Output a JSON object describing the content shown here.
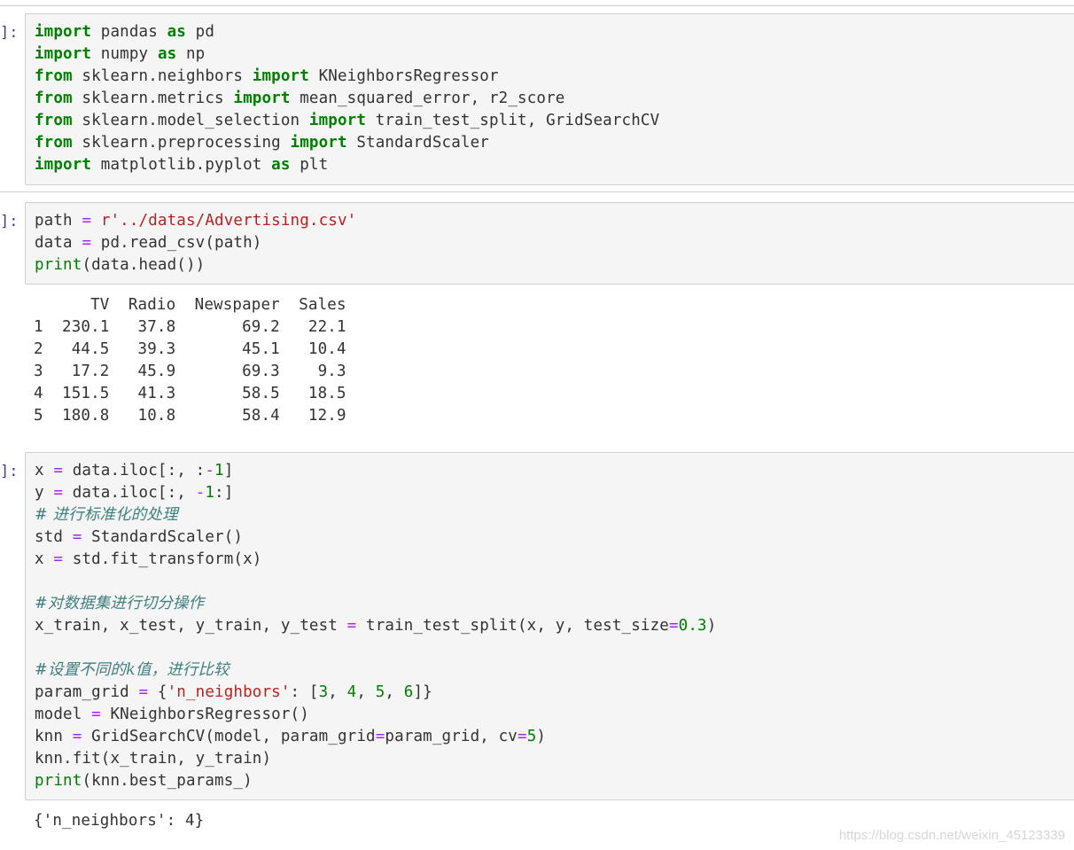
{
  "cells": [
    {
      "prompt": "]:",
      "lines": [
        [
          [
            "kw",
            "import"
          ],
          [
            "t",
            " pandas "
          ],
          [
            "kw",
            "as"
          ],
          [
            "t",
            " pd"
          ]
        ],
        [
          [
            "kw",
            "import"
          ],
          [
            "t",
            " numpy "
          ],
          [
            "kw",
            "as"
          ],
          [
            "t",
            " np"
          ]
        ],
        [
          [
            "kw",
            "from"
          ],
          [
            "t",
            " sklearn.neighbors "
          ],
          [
            "kw",
            "import"
          ],
          [
            "t",
            " KNeighborsRegressor"
          ]
        ],
        [
          [
            "kw",
            "from"
          ],
          [
            "t",
            " sklearn.metrics "
          ],
          [
            "kw",
            "import"
          ],
          [
            "t",
            " mean_squared_error, r2_score"
          ]
        ],
        [
          [
            "kw",
            "from"
          ],
          [
            "t",
            " sklearn.model_selection "
          ],
          [
            "kw",
            "import"
          ],
          [
            "t",
            " train_test_split, GridSearchCV"
          ]
        ],
        [
          [
            "kw",
            "from"
          ],
          [
            "t",
            " sklearn.preprocessing "
          ],
          [
            "kw",
            "import"
          ],
          [
            "t",
            " StandardScaler"
          ]
        ],
        [
          [
            "kw",
            "import"
          ],
          [
            "t",
            " matplotlib.pyplot "
          ],
          [
            "kw",
            "as"
          ],
          [
            "t",
            " plt"
          ]
        ]
      ]
    },
    {
      "prompt": "]:",
      "lines": [
        [
          [
            "t",
            "path "
          ],
          [
            "op",
            "="
          ],
          [
            "t",
            " "
          ],
          [
            "str",
            "r'../datas/Advertising.csv'"
          ]
        ],
        [
          [
            "t",
            "data "
          ],
          [
            "op",
            "="
          ],
          [
            "t",
            " pd.read_csv(path)"
          ]
        ],
        [
          [
            "bi",
            "print"
          ],
          [
            "t",
            "(data.head())"
          ]
        ]
      ],
      "output": [
        "      TV  Radio  Newspaper  Sales",
        "1  230.1   37.8       69.2   22.1",
        "2   44.5   39.3       45.1   10.4",
        "3   17.2   45.9       69.3    9.3",
        "4  151.5   41.3       58.5   18.5",
        "5  180.8   10.8       58.4   12.9"
      ]
    },
    {
      "prompt": "]:",
      "lines": [
        [
          [
            "t",
            "x "
          ],
          [
            "op",
            "="
          ],
          [
            "t",
            " data.iloc[:, :"
          ],
          [
            "op",
            "-"
          ],
          [
            "num",
            "1"
          ],
          [
            "t",
            "]"
          ]
        ],
        [
          [
            "t",
            "y "
          ],
          [
            "op",
            "="
          ],
          [
            "t",
            " data.iloc[:, "
          ],
          [
            "op",
            "-"
          ],
          [
            "num",
            "1"
          ],
          [
            "t",
            ":]"
          ]
        ],
        [
          [
            "cmt",
            "# 进行标准化的处理"
          ]
        ],
        [
          [
            "t",
            "std "
          ],
          [
            "op",
            "="
          ],
          [
            "t",
            " StandardScaler()"
          ]
        ],
        [
          [
            "t",
            "x "
          ],
          [
            "op",
            "="
          ],
          [
            "t",
            " std.fit_transform(x)"
          ]
        ],
        [
          [
            "t",
            ""
          ]
        ],
        [
          [
            "cmt",
            "#对数据集进行切分操作"
          ]
        ],
        [
          [
            "t",
            "x_train, x_test, y_train, y_test "
          ],
          [
            "op",
            "="
          ],
          [
            "t",
            " train_test_split(x, y, test_size"
          ],
          [
            "op",
            "="
          ],
          [
            "num",
            "0.3"
          ],
          [
            "t",
            ")"
          ]
        ],
        [
          [
            "t",
            ""
          ]
        ],
        [
          [
            "cmt",
            "#设置不同的k值，进行比较"
          ]
        ],
        [
          [
            "t",
            "param_grid "
          ],
          [
            "op",
            "="
          ],
          [
            "t",
            " {"
          ],
          [
            "str",
            "'n_neighbors'"
          ],
          [
            "t",
            ": ["
          ],
          [
            "num",
            "3"
          ],
          [
            "t",
            ", "
          ],
          [
            "num",
            "4"
          ],
          [
            "t",
            ", "
          ],
          [
            "num",
            "5"
          ],
          [
            "t",
            ", "
          ],
          [
            "num",
            "6"
          ],
          [
            "t",
            "]}"
          ]
        ],
        [
          [
            "t",
            "model "
          ],
          [
            "op",
            "="
          ],
          [
            "t",
            " KNeighborsRegressor()"
          ]
        ],
        [
          [
            "t",
            "knn "
          ],
          [
            "op",
            "="
          ],
          [
            "t",
            " GridSearchCV(model, param_grid"
          ],
          [
            "op",
            "="
          ],
          [
            "t",
            "param_grid, cv"
          ],
          [
            "op",
            "="
          ],
          [
            "num",
            "5"
          ],
          [
            "t",
            ")"
          ]
        ],
        [
          [
            "t",
            "knn.fit(x_train, y_train)"
          ]
        ],
        [
          [
            "bi",
            "print"
          ],
          [
            "t",
            "(knn.best_params_)"
          ]
        ]
      ],
      "output": [
        "{'n_neighbors': 4}"
      ]
    }
  ],
  "watermark": "https://blog.csdn.net/weixin_45123339"
}
